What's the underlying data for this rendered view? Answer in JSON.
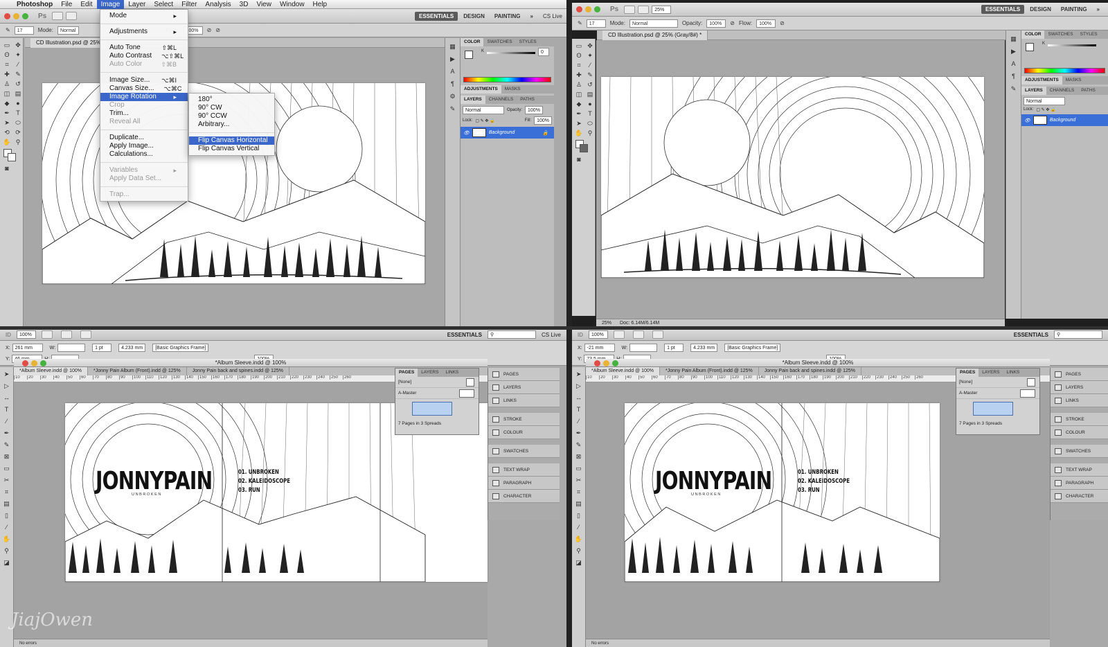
{
  "menubar": {
    "app": "Photoshop",
    "items": [
      "File",
      "Edit",
      "Image",
      "Layer",
      "Select",
      "Filter",
      "Analysis",
      "3D",
      "View",
      "Window",
      "Help"
    ]
  },
  "ps": {
    "logo": "Ps",
    "workspaces": [
      "ESSENTIALS",
      "DESIGN",
      "PAINTING"
    ],
    "cs_live": "CS Live",
    "options": {
      "mode_label": "Mode:",
      "mode_value": "Normal",
      "opacity_label": "Opacity:",
      "opacity_value": "100%",
      "flow_label": "Flow:",
      "flow_value": "100%",
      "brush_size": "17"
    },
    "zoom": "25%",
    "doc_tab_left": "CD Illustration.psd @ 25%",
    "doc_tab_right": "CD Illustration.psd @ 25% (Gray/8#) *",
    "status_zoom": "25%",
    "status_doc": "Doc: 6.14M/6.14M",
    "panels": {
      "color_tabs": [
        "COLOR",
        "SWATCHES",
        "STYLES"
      ],
      "adj_tabs": [
        "ADJUSTMENTS",
        "MASKS"
      ],
      "layer_tabs": [
        "LAYERS",
        "CHANNELS",
        "PATHS"
      ],
      "blend": "Normal",
      "opacity_label": "Opacity:",
      "opacity_value": "100%",
      "lock_label": "Lock:",
      "fill_label": "Fill:",
      "fill_value": "100%",
      "layer_name": "Background",
      "k_value": "0",
      "k_label": "K"
    }
  },
  "image_menu": {
    "items": [
      {
        "label": "Mode",
        "shortcut": "▸",
        "disabled": false
      },
      {
        "sep": true
      },
      {
        "label": "Adjustments",
        "shortcut": "▸",
        "disabled": false
      },
      {
        "sep": true
      },
      {
        "label": "Auto Tone",
        "shortcut": "⇧⌘L",
        "disabled": false
      },
      {
        "label": "Auto Contrast",
        "shortcut": "⌥⇧⌘L",
        "disabled": false
      },
      {
        "label": "Auto Color",
        "shortcut": "⇧⌘B",
        "disabled": true
      },
      {
        "sep": true
      },
      {
        "label": "Image Size...",
        "shortcut": "⌥⌘I",
        "disabled": false
      },
      {
        "label": "Canvas Size...",
        "shortcut": "⌥⌘C",
        "disabled": false
      },
      {
        "label": "Image Rotation",
        "shortcut": "▸",
        "disabled": false,
        "selected": true
      },
      {
        "label": "Crop",
        "shortcut": "",
        "disabled": true
      },
      {
        "label": "Trim...",
        "shortcut": "",
        "disabled": false
      },
      {
        "label": "Reveal All",
        "shortcut": "",
        "disabled": true
      },
      {
        "sep": true
      },
      {
        "label": "Duplicate...",
        "shortcut": "",
        "disabled": false
      },
      {
        "label": "Apply Image...",
        "shortcut": "",
        "disabled": false
      },
      {
        "label": "Calculations...",
        "shortcut": "",
        "disabled": false
      },
      {
        "sep": true
      },
      {
        "label": "Variables",
        "shortcut": "▸",
        "disabled": true
      },
      {
        "label": "Apply Data Set...",
        "shortcut": "",
        "disabled": true
      },
      {
        "sep": true
      },
      {
        "label": "Trap...",
        "shortcut": "",
        "disabled": true
      }
    ]
  },
  "rotation_menu": {
    "items": [
      {
        "label": "180°"
      },
      {
        "label": "90° CW"
      },
      {
        "label": "90° CCW"
      },
      {
        "label": "Arbitrary..."
      },
      {
        "sep": true
      },
      {
        "label": "Flip Canvas Horizontal",
        "selected": true
      },
      {
        "label": "Flip Canvas Vertical"
      }
    ]
  },
  "indesign": {
    "logo": "ID",
    "zoom": "100%",
    "essentials": "ESSENTIALS",
    "cs_live": "CS Live",
    "left": {
      "x": "261 mm",
      "y": "46 mm"
    },
    "right": {
      "x": "-21 mm",
      "y": "73.5 mm"
    },
    "x_label": "X:",
    "y_label": "Y:",
    "w_label": "W:",
    "h_label": "H:",
    "stroke_weight": "1 pt",
    "size_value": "4.233 mm",
    "frame_style": "[Basic Graphics Frame]",
    "percent": "100%",
    "doc_title": "*Album Sleeve.indd @ 100%",
    "tabs": [
      "*Album Sleeve.indd @ 100%",
      "*Jonny Pain Album (Front).indd @ 125%",
      "Jonny Pain back and spines.indd @ 125%"
    ],
    "ruler_marks": [
      "10",
      "20",
      "30",
      "40",
      "50",
      "60",
      "70",
      "80",
      "90",
      "100",
      "110",
      "120",
      "130",
      "140",
      "150",
      "160",
      "170",
      "180",
      "190",
      "200",
      "210",
      "220",
      "230",
      "240",
      "250",
      "260"
    ],
    "pages_tabs": [
      "PAGES",
      "LAYERS",
      "LINKS"
    ],
    "pages_none": "[None]",
    "pages_master": "A-Master",
    "pages_footer": "7 Pages in 3 Spreads",
    "dock": [
      "PAGES",
      "LAYERS",
      "LINKS",
      "STROKE",
      "COLOUR",
      "SWATCHES",
      "TEXT WRAP",
      "PARAGRAPH",
      "CHARACTER"
    ],
    "status_errors": "No errors"
  },
  "sleeve": {
    "title": "JONNYPAIN",
    "subtitle": "UNBROKEN",
    "tracks": [
      "01. UNBROKEN",
      "02. KALEIDOSCOPE",
      "03. RUN"
    ]
  },
  "watermark": "JiajOwen"
}
